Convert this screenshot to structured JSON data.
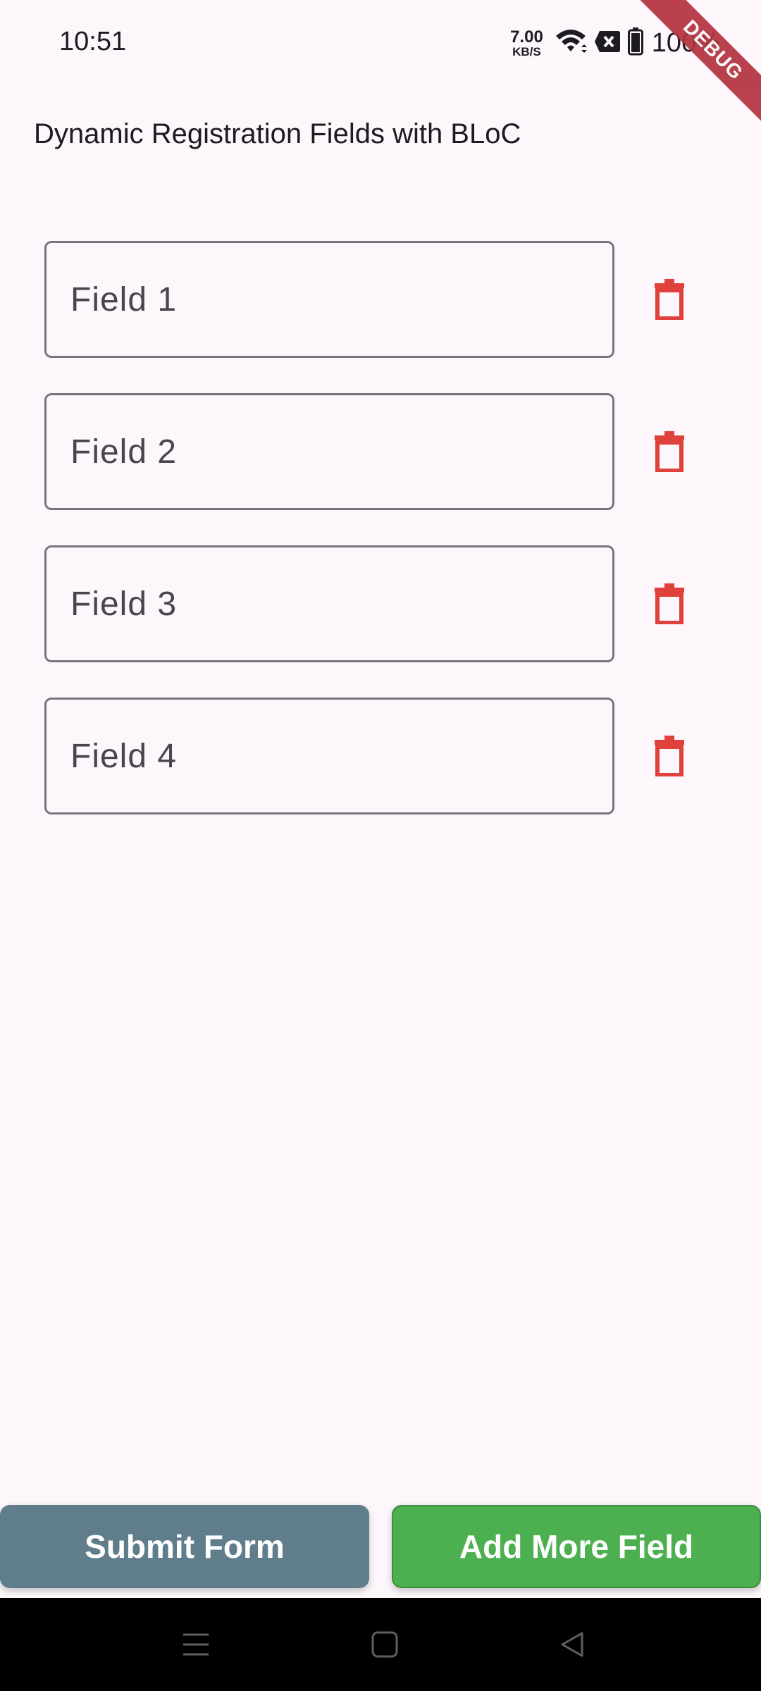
{
  "status_bar": {
    "time": "10:51",
    "net_speed_value": "7.00",
    "net_speed_unit": "KB/S",
    "battery_percent": "100%"
  },
  "debug_banner": {
    "label": "DEBUG"
  },
  "app_bar": {
    "title": "Dynamic Registration Fields with BLoC"
  },
  "fields": [
    {
      "placeholder": "Field 1"
    },
    {
      "placeholder": "Field 2"
    },
    {
      "placeholder": "Field 3"
    },
    {
      "placeholder": "Field 4"
    }
  ],
  "buttons": {
    "submit_label": "Submit Form",
    "add_label": "Add More Field"
  },
  "colors": {
    "background": "#fdf7fc",
    "delete_icon": "#e0413a",
    "submit_button": "#607d8b",
    "add_button": "#4caf50",
    "field_border": "#79747e"
  },
  "icons": {
    "delete": "trash-icon",
    "nav_menu": "menu-icon",
    "nav_home": "home-icon",
    "nav_back": "back-icon"
  }
}
